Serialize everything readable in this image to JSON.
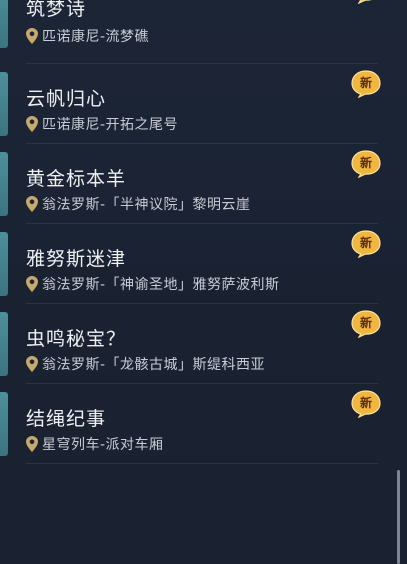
{
  "entries": [
    {
      "title": "筑梦诗",
      "location": "匹诺康尼-流梦礁",
      "badge": "新",
      "icon": "location-pin-icon"
    },
    {
      "title": "云帆归心",
      "location": "匹诺康尼-开拓之尾号",
      "badge": "新",
      "icon": "location-pin-icon"
    },
    {
      "title": "黄金标本羊",
      "location": "翁法罗斯-「半神议院」黎明云崖",
      "badge": "新",
      "icon": "location-pin-icon"
    },
    {
      "title": "雅努斯迷津",
      "location": "翁法罗斯-「神谕圣地」雅努萨波利斯",
      "badge": "新",
      "icon": "location-pin-icon"
    },
    {
      "title": "虫鸣秘宝？",
      "location": "翁法罗斯-「龙骸古城」斯缇科西亚",
      "badge": "新",
      "icon": "location-pin-icon"
    },
    {
      "title": "结绳纪事",
      "location": "星穹列车-派对车厢",
      "badge": "新",
      "icon": "location-pin-icon"
    }
  ],
  "colors": {
    "accent": "#4e8f9c",
    "pin": "#c9a86a",
    "badge": "#f0b640"
  }
}
